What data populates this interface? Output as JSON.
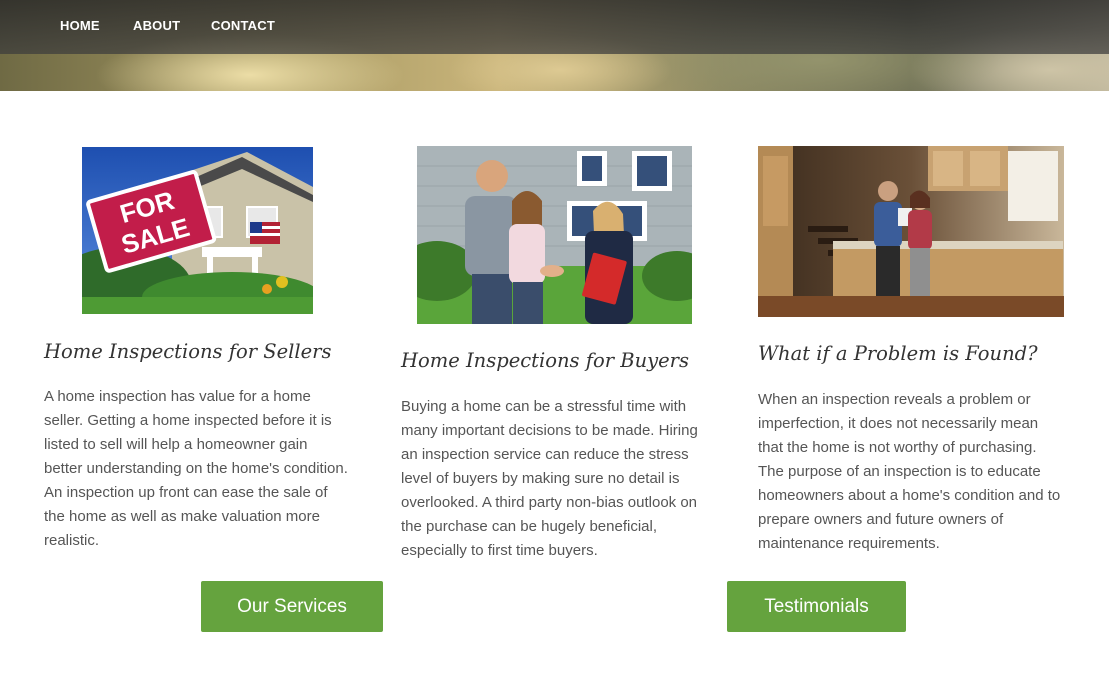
{
  "nav": {
    "items": [
      {
        "label": "HOME"
      },
      {
        "label": "ABOUT"
      },
      {
        "label": "CONTACT"
      }
    ]
  },
  "columns": [
    {
      "image": "for-sale-sign-house-photo",
      "heading": "Home Inspections for Sellers",
      "body": "A home inspection has value for a home seller. Getting a home inspected before it is listed to sell will help a homeowner gain better understanding on the home's condition. An inspection up front can ease the sale of the home as well as make valuation more realistic.",
      "sign_text": "FOR SALE"
    },
    {
      "image": "buyers-handshake-photo",
      "heading": "Home Inspections for Buyers",
      "body": "Buying a home can be a stressful time with many important decisions to be made. Hiring an inspection service can reduce the stress level of buyers by making sure no detail is overlooked. A third party non-bias outlook on the purchase can be hugely beneficial, especially to first time buyers."
    },
    {
      "image": "kitchen-inspection-photo",
      "heading": "What if a Problem is Found?",
      "body": "When an inspection reveals a problem or imperfection, it does not necessarily mean that the home is not worthy of purchasing. The purpose of an inspection is to educate homeowners about a home's condition and to prepare owners and future owners of maintenance requirements."
    }
  ],
  "buttons": {
    "services": "Our Services",
    "testimonials": "Testimonials"
  },
  "colors": {
    "accent": "#65a33e",
    "nav_text": "#ffffff",
    "body_text": "#555555"
  }
}
